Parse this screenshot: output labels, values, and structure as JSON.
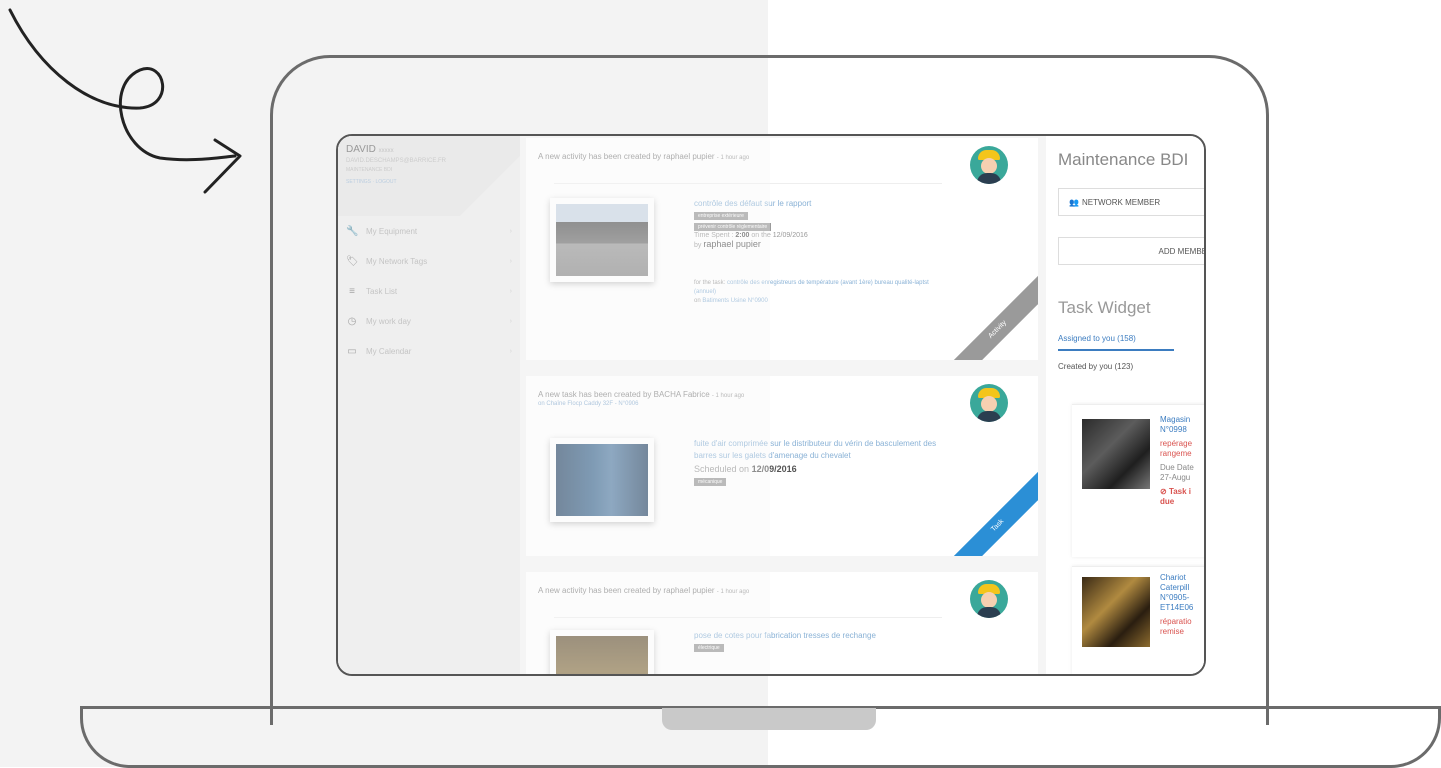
{
  "sidebar": {
    "profile": {
      "name": "DAVID",
      "name_suffix": "xxxxx",
      "email": "DAVID.DESCHAMPS@BARRICE.FR",
      "role": "MAINTENANCE BDI",
      "links": "SETTINGS · LOGOUT"
    },
    "items": [
      {
        "icon": "wrench-icon",
        "glyph": "🔧",
        "label": "My Equipment"
      },
      {
        "icon": "tags-icon",
        "glyph": "🏷",
        "label": "My Network Tags"
      },
      {
        "icon": "list-icon",
        "glyph": "≡",
        "label": "Task List"
      },
      {
        "icon": "clock-icon",
        "glyph": "◷",
        "label": "My work day"
      },
      {
        "icon": "calendar-icon",
        "glyph": "▭",
        "label": "My Calendar"
      }
    ],
    "chevron": "›"
  },
  "feed": {
    "cards": [
      {
        "header": "A new activity has been created by raphael pupier",
        "ago": "- 1 hour ago",
        "title": "contrôle des défaut sur le rapport",
        "tags": [
          "entreprise extérieure",
          "prévenir contrôle réglementaire"
        ],
        "time_spent_label": "Time Spent :",
        "time_spent": "2:00",
        "time_spent_on": "on the 12/09/2016",
        "by_label": "by",
        "by": "raphael pupier",
        "task_label": "for the task:",
        "task_link": "contrôle des enregistreurs de température (avant 1ère) bureau qualité-laptst (annuel)",
        "on_label": "on",
        "on_link": "Batiments Usine N°0900",
        "ribbon": "Activity",
        "ribbon_color": "#9a9a9a"
      },
      {
        "header": "A new task has been created by BACHA Fabrice",
        "ago": "- 1 hour ago",
        "on_label": "on",
        "on_link": "Chaîne Flocp Caddy 32F - N°0906",
        "title": "fuite d'air comprimée sur le distributeur du vérin de basculement des barres sur les galets d'amenage du chevalet",
        "scheduled_label": "Scheduled on",
        "scheduled": "12/09/2016",
        "tags": [
          "mécanique"
        ],
        "ribbon": "Task",
        "ribbon_color": "#2b8fd6"
      },
      {
        "header": "A new activity has been created by raphael pupier",
        "ago": "- 1 hour ago",
        "title": "pose de cotes pour fabrication tresses de rechange",
        "tags": [
          "électrique"
        ]
      }
    ]
  },
  "right": {
    "title": "Maintenance BDI",
    "network_btn": "NETWORK MEMBER",
    "add_btn": "ADD MEMBE",
    "widget_title": "Task Widget",
    "tab_assigned": "Assigned to you (158)",
    "tab_created": "Created by you (123)",
    "tasks": [
      {
        "line1": "Magasin",
        "line2": "N°0998",
        "line3": "repérage",
        "line4": "rangeme",
        "line5": "Due Date",
        "line6": "27-Augu",
        "line7": "Task i",
        "line8": "due"
      },
      {
        "line1": "Chariot",
        "line2": "Caterpill",
        "line3": "N°0905-",
        "line4": "ET14E06",
        "line5": "réparatio",
        "line6": "remise"
      }
    ]
  }
}
